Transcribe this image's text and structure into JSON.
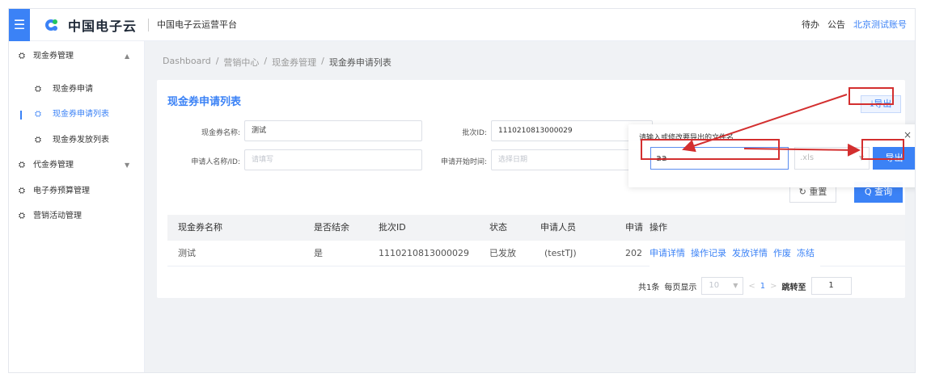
{
  "header": {
    "menu_icon": "menu-icon",
    "logo_text": "中国电子云",
    "platform": "中国电子云运营平台",
    "todo": "待办",
    "notice": "公告",
    "account": "北京测试账号"
  },
  "sidebar": {
    "items": [
      {
        "label": "现金券管理",
        "icon": "gauge-icon",
        "arrow": "▲"
      },
      {
        "label": "现金券申请",
        "icon": "gauge-icon"
      },
      {
        "label": "现金券申请列表",
        "icon": "gauge-icon",
        "active": true
      },
      {
        "label": "现金券发放列表",
        "icon": "gauge-icon"
      },
      {
        "label": "代金券管理",
        "icon": "gauge-icon",
        "arrow": "▼"
      },
      {
        "label": "电子券预算管理",
        "icon": "gauge-icon"
      },
      {
        "label": "营销活动管理",
        "icon": "gauge-icon"
      }
    ]
  },
  "breadcrumb": [
    "Dashboard",
    "/",
    "营销中心",
    "/",
    "现金券管理",
    "/",
    "现金券申请列表"
  ],
  "page": {
    "title": "现金券申请列表",
    "export_label": "⤓导出"
  },
  "filters": {
    "name_label": "现金券名称:",
    "name_value": "测试",
    "batch_label": "批次ID:",
    "batch_value": "1110210813000029",
    "applicant_label": "申请人名称/ID:",
    "applicant_placeholder": "请填写",
    "start_label": "申请开始时间:",
    "start_placeholder": "选择日期",
    "reset_label": "↻ 重置",
    "query_label": "Q 查询"
  },
  "table": {
    "headers": [
      "现金券名称",
      "是否结余",
      "批次ID",
      "状态",
      "申请人员",
      "申请",
      "操作"
    ],
    "rows": [
      [
        "测试",
        "是",
        "1110210813000029",
        "已发放",
        "(testTJ)",
        "202"
      ]
    ],
    "ops": [
      "申请详情",
      "操作记录",
      "发放详情",
      "作废",
      "冻结"
    ]
  },
  "pager": {
    "total": "共1条",
    "per_page_label": "每页显示",
    "per_page": "10",
    "prev": "<",
    "page": "1",
    "next": ">",
    "jump_label": "跳转至",
    "jump_value": "1"
  },
  "dialog": {
    "title": "请输入或修改要导出的文件名",
    "close": "×",
    "filename": "aa",
    "ext": ".xls",
    "export_label": "导出"
  },
  "colors": {
    "accent": "#3b82f6",
    "annotation": "#d32f2f"
  }
}
